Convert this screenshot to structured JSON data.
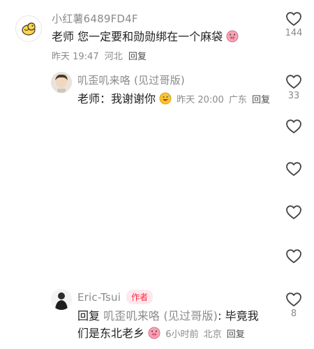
{
  "comment1": {
    "username": "小红薯6489FD4F",
    "text": "老师  您一定要和勋勋绑在一个麻袋",
    "time": "昨天 19:47",
    "location": "河北",
    "reply_label": "回复",
    "likes": "144"
  },
  "reply1": {
    "username": "叽歪叽来咯 (见过哥版)",
    "text": "老师：我谢谢你",
    "time": "昨天 20:00",
    "location": "广东",
    "reply_label": "回复",
    "likes": "33"
  },
  "reply2": {
    "username": "Eric-Tsui",
    "author_badge": "作者",
    "reply_prefix": "回复",
    "reply_target": "叽歪叽来咯 (见过哥版)",
    "text_line1_rest": ": 毕竟我",
    "text_line2": "们是东北老乡",
    "time": "6小时前",
    "location": "北京",
    "reply_label": "回复",
    "likes": "8"
  },
  "icons": {
    "heart": "heart-outline-icon",
    "emoji_pig": "pig-face-emoji",
    "emoji_sweat": "sweat-smile-emoji"
  },
  "colors": {
    "accent": "#ff2442",
    "muted": "#8a8a8a",
    "heart_stroke": "#444444"
  }
}
